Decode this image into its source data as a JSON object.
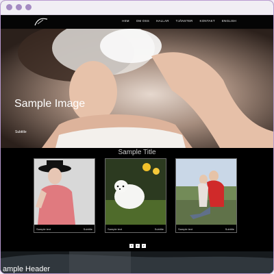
{
  "window": {
    "dots": [
      "close-dot",
      "minimize-dot",
      "maximize-dot"
    ]
  },
  "nav": {
    "items": [
      "HEM",
      "OM OSS",
      "HALLAR",
      "TJÄNSTER",
      "KONTAKT",
      "ENGLISH"
    ]
  },
  "hero": {
    "title": "Sample Image",
    "subtitle": "Subtitle"
  },
  "section": {
    "title": "Sample Title"
  },
  "cards": [
    {
      "text": "Sample text",
      "subtitle": "Subtitle"
    },
    {
      "text": "Sample text",
      "subtitle": "Subtitle"
    },
    {
      "text": "Sample text",
      "subtitle": "Subtitle"
    }
  ],
  "social": {
    "icons": [
      "facebook-icon",
      "twitter-icon",
      "rss-icon"
    ],
    "labels": [
      "f",
      "t",
      "r"
    ]
  },
  "footer": {
    "header": "ample Header"
  },
  "colors": {
    "accent": "#a58bc2",
    "background": "#000000",
    "text": "#ffffff"
  }
}
